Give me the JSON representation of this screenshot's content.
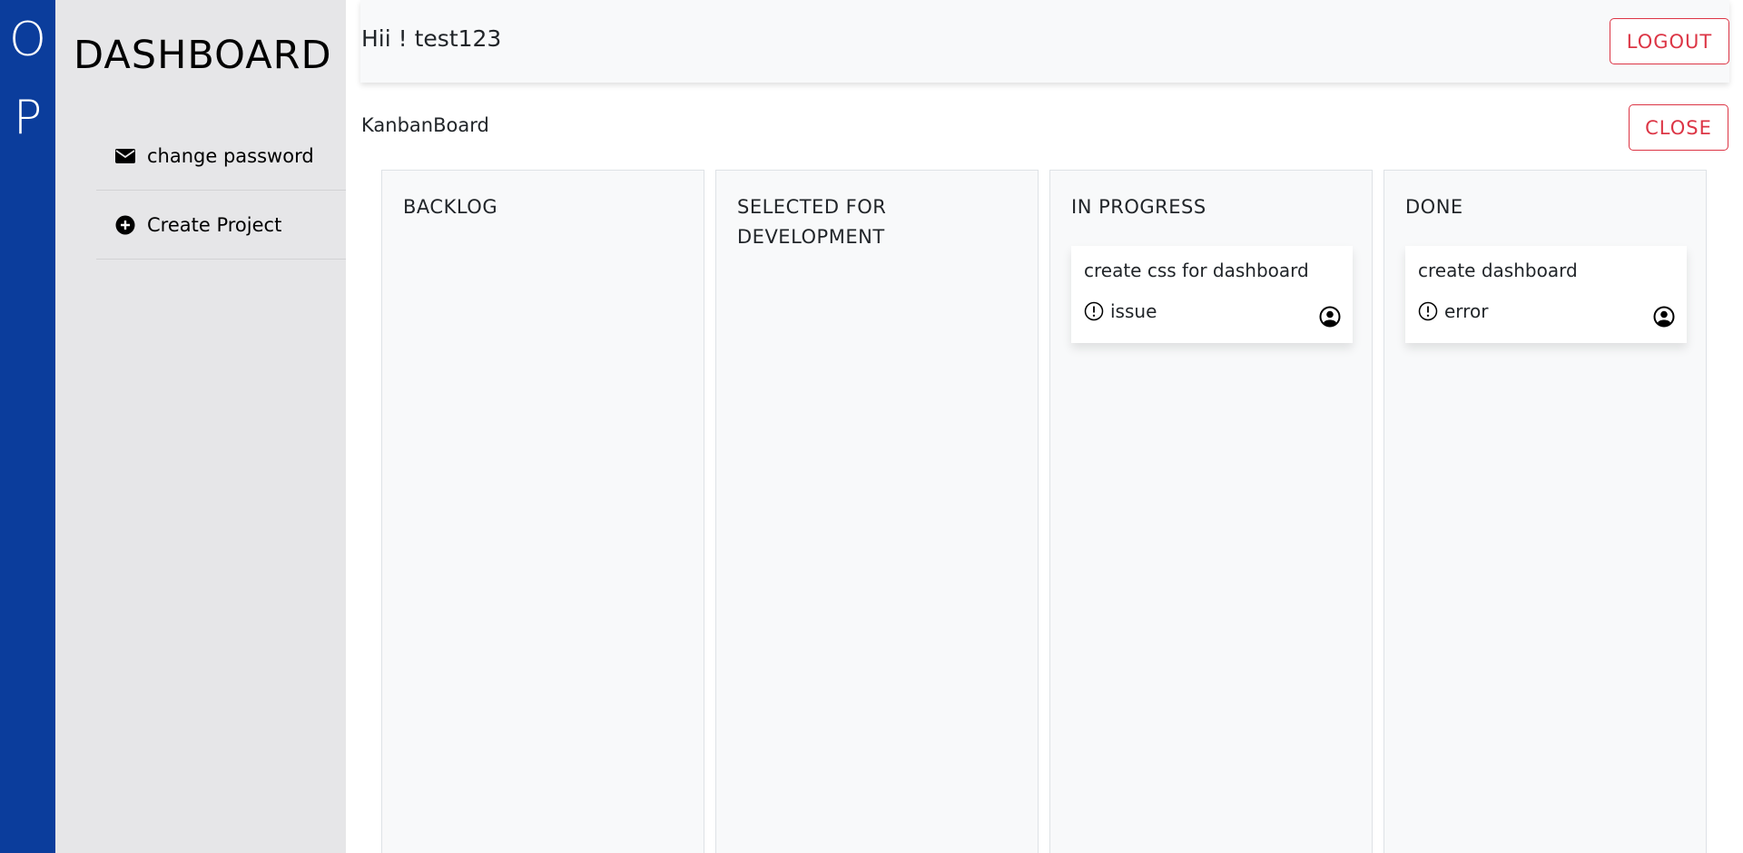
{
  "brand": {
    "letters": [
      "O",
      "P"
    ],
    "color": "#0b3d9c"
  },
  "sidebar": {
    "title": "DASHBOARD",
    "items": [
      {
        "label": "change password",
        "icon": "envelope-icon"
      },
      {
        "label": "Create Project",
        "icon": "plus-circle-icon"
      }
    ]
  },
  "header": {
    "greeting": "Hii ! test123",
    "logout_label": "LOGOUT"
  },
  "board": {
    "title": "KanbanBoard",
    "close_label": "CLOSE",
    "columns": [
      {
        "title": "BACKLOG",
        "cards": []
      },
      {
        "title": "SELECTED FOR DEVELOPMENT",
        "cards": []
      },
      {
        "title": "IN PROGRESS",
        "cards": [
          {
            "title": "create css for dashboard",
            "type": "issue",
            "type_icon": "alert-circle-icon",
            "assignee_icon": "user-circle-icon"
          }
        ]
      },
      {
        "title": "DONE",
        "cards": [
          {
            "title": "create dashboard",
            "type": "error",
            "type_icon": "alert-circle-icon",
            "assignee_icon": "user-circle-icon"
          }
        ]
      }
    ]
  },
  "colors": {
    "danger": "#dc3545",
    "sidebar_bg": "#e6e6e8",
    "column_bg": "#f8f9fa"
  }
}
